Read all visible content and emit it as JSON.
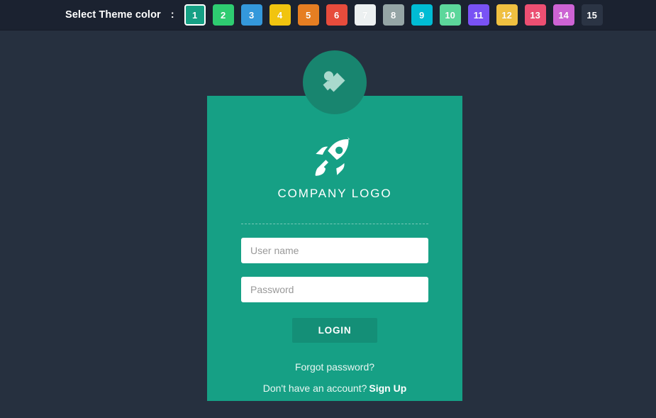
{
  "theme_bar": {
    "label": "Select Theme color",
    "separator": ":",
    "selected_index": 1,
    "swatches": [
      {
        "label": "1",
        "color": "#16a085",
        "selected": true
      },
      {
        "label": "2",
        "color": "#2ecc71",
        "selected": false
      },
      {
        "label": "3",
        "color": "#3498db",
        "selected": false
      },
      {
        "label": "4",
        "color": "#f1c40f",
        "selected": false
      },
      {
        "label": "5",
        "color": "#e67e22",
        "selected": false
      },
      {
        "label": "6",
        "color": "#e74c3c",
        "selected": false
      },
      {
        "label": "7",
        "color": "#ecf0f1",
        "selected": false
      },
      {
        "label": "8",
        "color": "#95a5a6",
        "selected": false
      },
      {
        "label": "9",
        "color": "#00bcd4",
        "selected": false
      },
      {
        "label": "10",
        "color": "#5cd79b",
        "selected": false
      },
      {
        "label": "11",
        "color": "#7952f5",
        "selected": false
      },
      {
        "label": "12",
        "color": "#f0c040",
        "selected": false
      },
      {
        "label": "13",
        "color": "#ec4f72",
        "selected": false
      },
      {
        "label": "14",
        "color": "#cd63d4",
        "selected": false
      },
      {
        "label": "15",
        "color": "#2b3444",
        "selected": false
      }
    ]
  },
  "avatar": {
    "icon": "broken-image-icon",
    "background": "#18856f"
  },
  "card": {
    "background": "#16a085",
    "logo_icon": "rocket-icon",
    "company_name": "COMPANY LOGO",
    "username": {
      "placeholder": "User name",
      "value": ""
    },
    "password": {
      "placeholder": "Password",
      "value": ""
    },
    "login_label": "LOGIN",
    "forgot_label": "Forgot password?",
    "signup_prompt": "Don't have an account?",
    "signup_label": "Sign Up"
  },
  "page": {
    "background": "#26303f",
    "bar_background": "#1b2230"
  }
}
